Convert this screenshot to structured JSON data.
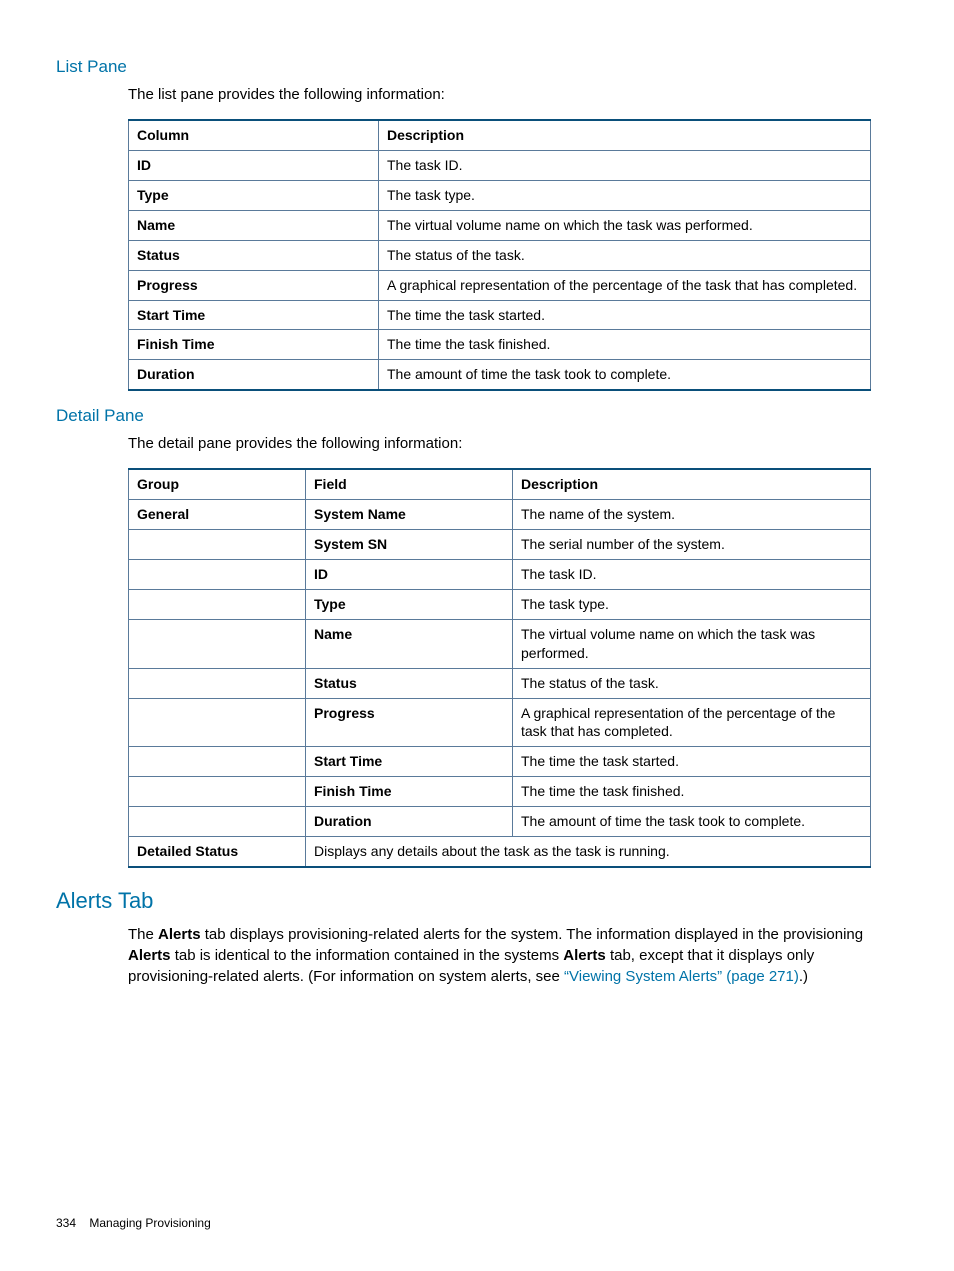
{
  "sections": {
    "listPane": {
      "heading": "List Pane",
      "intro": "The list pane provides the following information:",
      "table": {
        "headers": {
          "c1": "Column",
          "c2": "Description"
        },
        "rows": [
          {
            "c1": "ID",
            "c2": "The task ID."
          },
          {
            "c1": "Type",
            "c2": "The task type."
          },
          {
            "c1": "Name",
            "c2": "The virtual volume name on which the task was performed."
          },
          {
            "c1": "Status",
            "c2": "The status of the task."
          },
          {
            "c1": "Progress",
            "c2": "A graphical representation of the percentage of the task that has completed."
          },
          {
            "c1": "Start Time",
            "c2": "The time the task started."
          },
          {
            "c1": "Finish Time",
            "c2": "The time the task finished."
          },
          {
            "c1": "Duration",
            "c2": "The amount of time the task took to complete."
          }
        ]
      }
    },
    "detailPane": {
      "heading": "Detail Pane",
      "intro": "The detail pane provides the following information:",
      "table": {
        "headers": {
          "c1": "Group",
          "c2": "Field",
          "c3": "Description"
        },
        "rows": [
          {
            "c1": "General",
            "c2": "System Name",
            "c3": "The name of the system."
          },
          {
            "c1": "",
            "c2": "System SN",
            "c3": "The serial number of the system."
          },
          {
            "c1": "",
            "c2": "ID",
            "c3": "The task ID."
          },
          {
            "c1": "",
            "c2": "Type",
            "c3": "The task type."
          },
          {
            "c1": "",
            "c2": "Name",
            "c3": "The virtual volume name on which the task was performed."
          },
          {
            "c1": "",
            "c2": "Status",
            "c3": "The status of the task."
          },
          {
            "c1": "",
            "c2": "Progress",
            "c3": "A graphical representation of the percentage of the task that has completed."
          },
          {
            "c1": "",
            "c2": "Start Time",
            "c3": "The time the task started."
          },
          {
            "c1": "",
            "c2": "Finish Time",
            "c3": "The time the task finished."
          },
          {
            "c1": "",
            "c2": "Duration",
            "c3": "The amount of time the task took to complete."
          }
        ],
        "lastRow": {
          "c1": "Detailed Status",
          "span": "Displays any details about the task as the task is running."
        }
      }
    },
    "alertsTab": {
      "heading": "Alerts Tab",
      "para": {
        "t1": "The ",
        "b1": "Alerts",
        "t2": " tab displays provisioning-related alerts for the system. The information displayed in the provisioning ",
        "b2": "Alerts",
        "t3": " tab is identical to the information contained in the systems ",
        "b3": "Alerts",
        "t4": " tab, except that it displays only provisioning-related alerts. (For information on system alerts, see ",
        "link": "“Viewing System Alerts” (page 271)",
        "t5": ".)"
      }
    }
  },
  "footer": {
    "pageNumber": "334",
    "chapter": "Managing Provisioning"
  }
}
